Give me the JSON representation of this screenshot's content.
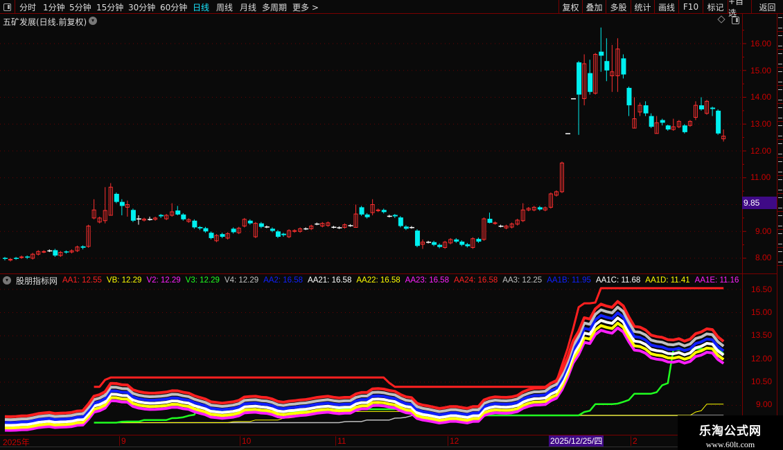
{
  "topbar": {
    "periods": [
      "分时",
      "1分钟",
      "5分钟",
      "15分钟",
      "30分钟",
      "60分钟",
      "日线",
      "周线",
      "月线",
      "多周期",
      "更多 >"
    ],
    "active_period": "日线",
    "tools": [
      "复权",
      "叠加",
      "多股",
      "统计",
      "画线",
      "F10",
      "标记",
      "+自选",
      "返回"
    ]
  },
  "main": {
    "title": "五矿发展(日线.前复权)",
    "price_axis": [
      "16.00",
      "15.00",
      "14.00",
      "13.00",
      "12.00",
      "11.00",
      "9.00",
      "8.00"
    ],
    "current_price_tag": "9.85"
  },
  "indicator": {
    "name": "股朋指标网",
    "legend": [
      {
        "label": "AA1: 12.55",
        "color": "#ff2020"
      },
      {
        "label": "VB: 12.29",
        "color": "#ffff00"
      },
      {
        "label": "V2: 12.29",
        "color": "#ff20ff"
      },
      {
        "label": "V3: 12.29",
        "color": "#20ff20"
      },
      {
        "label": "V4: 12.29",
        "color": "#c0c0c0"
      },
      {
        "label": "AA2: 16.58",
        "color": "#1020ff"
      },
      {
        "label": "AA21: 16.58",
        "color": "#ffffff"
      },
      {
        "label": "AA22: 16.58",
        "color": "#ffff00"
      },
      {
        "label": "AA23: 16.58",
        "color": "#ff20ff"
      },
      {
        "label": "AA24: 16.58",
        "color": "#ff2020"
      },
      {
        "label": "AA3: 12.25",
        "color": "#c0c0c0"
      },
      {
        "label": "AA1B: 11.95",
        "color": "#1020ff"
      },
      {
        "label": "AA1C: 11.68",
        "color": "#ffffff"
      },
      {
        "label": "AA1D: 11.41",
        "color": "#ffff00"
      },
      {
        "label": "AA1E: 11.16",
        "color": "#ff20ff"
      }
    ],
    "axis": [
      "16.50",
      "15.00",
      "13.50",
      "12.00",
      "10.50",
      "9.00"
    ]
  },
  "date_axis": {
    "labels": [
      "2025年",
      "9",
      "10",
      "11",
      "12",
      "2"
    ],
    "cursor_date": "2025/12/25/四"
  },
  "watermark": {
    "line1": "乐淘公式网",
    "line2": "www.60lt.com"
  },
  "colors": {
    "up": "#ff3030",
    "down": "#00f0f0",
    "grid": "#6a0000",
    "axis": "#c80000"
  },
  "chart_data": {
    "type": "candlestick",
    "main_range": [
      8.0,
      16.0
    ],
    "indicator_range": [
      9.0,
      16.5
    ],
    "band_ratios": {
      "AA1": 1.0,
      "AA3": 0.976,
      "AA1B": 0.952,
      "AA1C": 0.931,
      "AA1D": 0.909,
      "AA1E": 0.889
    },
    "candles_oc_hl": [
      [
        8.0,
        7.97
      ],
      [
        7.93,
        7.96
      ],
      [
        8.0,
        7.99
      ],
      [
        8.03,
        8.05
      ],
      [
        8.05,
        8.02
      ],
      [
        8.0,
        8.15
      ],
      [
        8.15,
        8.25
      ],
      [
        8.24,
        8.25
      ],
      [
        8.28,
        8.28
      ],
      [
        8.3,
        8.1
      ],
      [
        8.1,
        8.22
      ],
      [
        8.24,
        8.22
      ],
      [
        8.23,
        8.28
      ],
      [
        8.28,
        8.42
      ],
      [
        8.43,
        8.38
      ],
      [
        8.44,
        9.2
      ],
      [
        9.5,
        9.8,
        10.2,
        9.45
      ],
      [
        9.35,
        9.5
      ],
      [
        9.4,
        9.78,
        10.65,
        9.3
      ],
      [
        9.6,
        10.65,
        10.8,
        9.6
      ],
      [
        10.4,
        10.1,
        10.45,
        10.05
      ],
      [
        10.1,
        9.95,
        10.2,
        9.6
      ],
      [
        9.9,
        10.0,
        10.15,
        9.55
      ],
      [
        9.8,
        9.4
      ],
      [
        9.47,
        9.47,
        9.6,
        9.25
      ],
      [
        9.42,
        9.46
      ],
      [
        9.45,
        9.45,
        9.55,
        9.4
      ],
      [
        9.45,
        9.5
      ],
      [
        9.6,
        9.55
      ],
      [
        9.47,
        9.6
      ],
      [
        9.6,
        9.73,
        10.05,
        9.55
      ],
      [
        9.78,
        9.63,
        9.95,
        9.6
      ],
      [
        9.63,
        9.45
      ],
      [
        9.37,
        9.44
      ],
      [
        9.4,
        9.15
      ],
      [
        9.15,
        9.1
      ],
      [
        9.12,
        9.0
      ],
      [
        8.95,
        8.75
      ],
      [
        8.65,
        8.85
      ],
      [
        8.9,
        8.8
      ],
      [
        8.75,
        8.92
      ],
      [
        9.1,
        8.97
      ],
      [
        8.95,
        9.12
      ],
      [
        9.2,
        9.45
      ],
      [
        9.4,
        9.3
      ],
      [
        8.8,
        9.3
      ],
      [
        9.3,
        9.17
      ],
      [
        9.17,
        9.17
      ],
      [
        9.1,
        9.02
      ],
      [
        9.0,
        8.8
      ],
      [
        8.9,
        8.85
      ],
      [
        8.8,
        9.03
      ],
      [
        9.0,
        9.03
      ],
      [
        9.0,
        9.1
      ],
      [
        9.1,
        9.1
      ],
      [
        9.1,
        9.2
      ],
      [
        9.28,
        9.28
      ],
      [
        9.2,
        9.3
      ],
      [
        9.22,
        9.32
      ],
      [
        9.16,
        9.16
      ],
      [
        9.14,
        9.14
      ],
      [
        9.15,
        9.25
      ],
      [
        9.22,
        9.22
      ],
      [
        9.15,
        9.65,
        10.0,
        9.15
      ],
      [
        9.9,
        9.63
      ],
      [
        9.63,
        9.53
      ],
      [
        9.7,
        10.0,
        10.2,
        9.6
      ],
      [
        9.77,
        9.8
      ],
      [
        9.8,
        9.72
      ],
      [
        9.57,
        9.57
      ],
      [
        9.6,
        9.55
      ],
      [
        9.52,
        9.2
      ],
      [
        9.18,
        9.1
      ],
      [
        9.15,
        9.15
      ],
      [
        9.03,
        8.46
      ],
      [
        8.52,
        8.6,
        8.7,
        8.35
      ],
      [
        8.6,
        8.6
      ],
      [
        8.6,
        8.5
      ],
      [
        8.5,
        8.42
      ],
      [
        8.4,
        8.6
      ],
      [
        8.57,
        8.7
      ],
      [
        8.7,
        8.62
      ],
      [
        8.62,
        8.5
      ],
      [
        8.52,
        8.45
      ],
      [
        8.4,
        8.73
      ],
      [
        8.72,
        8.62
      ],
      [
        8.7,
        9.47
      ],
      [
        9.47,
        9.32,
        9.7,
        9.3
      ],
      [
        9.3,
        9.32
      ],
      [
        9.2,
        9.2
      ],
      [
        9.13,
        9.2
      ],
      [
        9.16,
        9.28
      ],
      [
        9.27,
        9.42
      ],
      [
        9.4,
        9.8,
        10.05,
        9.35
      ],
      [
        9.8,
        9.86
      ],
      [
        9.8,
        9.9
      ],
      [
        9.9,
        9.82
      ],
      [
        9.8,
        9.88
      ],
      [
        9.9,
        10.4
      ],
      [
        10.35,
        10.48
      ],
      [
        10.48,
        11.55
      ],
      [
        12.65,
        12.65,
        12.65,
        12.65
      ],
      [
        13.95,
        13.95,
        13.95,
        13.95
      ],
      [
        15.3,
        14.1,
        15.35,
        12.6
      ],
      [
        13.95,
        15.25,
        15.6,
        13.7
      ],
      [
        14.9,
        14.2,
        15.4,
        14.1
      ],
      [
        14.15,
        15.6
      ],
      [
        15.7,
        15.55,
        16.6,
        14.95
      ],
      [
        15.35,
        15.0,
        16.2,
        14.6
      ],
      [
        14.8,
        14.95,
        15.95,
        14.2
      ],
      [
        14.8,
        15.8,
        16.2,
        14.2
      ],
      [
        15.45,
        14.85,
        15.6,
        14.7
      ],
      [
        14.35,
        13.7,
        14.4,
        13.3
      ],
      [
        12.85,
        13.2,
        14.0,
        12.85
      ],
      [
        13.45,
        13.7,
        13.8,
        13.3
      ],
      [
        13.7,
        13.4,
        13.85,
        13.3
      ],
      [
        13.3,
        12.9,
        13.4,
        12.85
      ],
      [
        12.65,
        13.05,
        13.3,
        12.65
      ],
      [
        13.15,
        13.05,
        13.2,
        12.95
      ],
      [
        12.95,
        12.8,
        12.98,
        12.75
      ],
      [
        12.8,
        12.9,
        13.2,
        12.75
      ],
      [
        12.9,
        13.1,
        13.15,
        12.85
      ],
      [
        12.95,
        12.7
      ],
      [
        12.95,
        13.1,
        13.15,
        12.9
      ],
      [
        13.25,
        13.7,
        13.85,
        13.15
      ],
      [
        13.7,
        13.55,
        14.0,
        13.5
      ],
      [
        13.4,
        13.85,
        13.9,
        13.35
      ],
      [
        13.6,
        13.55,
        13.65,
        13.3
      ],
      [
        13.5,
        12.65
      ],
      [
        12.45,
        12.55,
        12.8,
        12.35
      ]
    ]
  }
}
